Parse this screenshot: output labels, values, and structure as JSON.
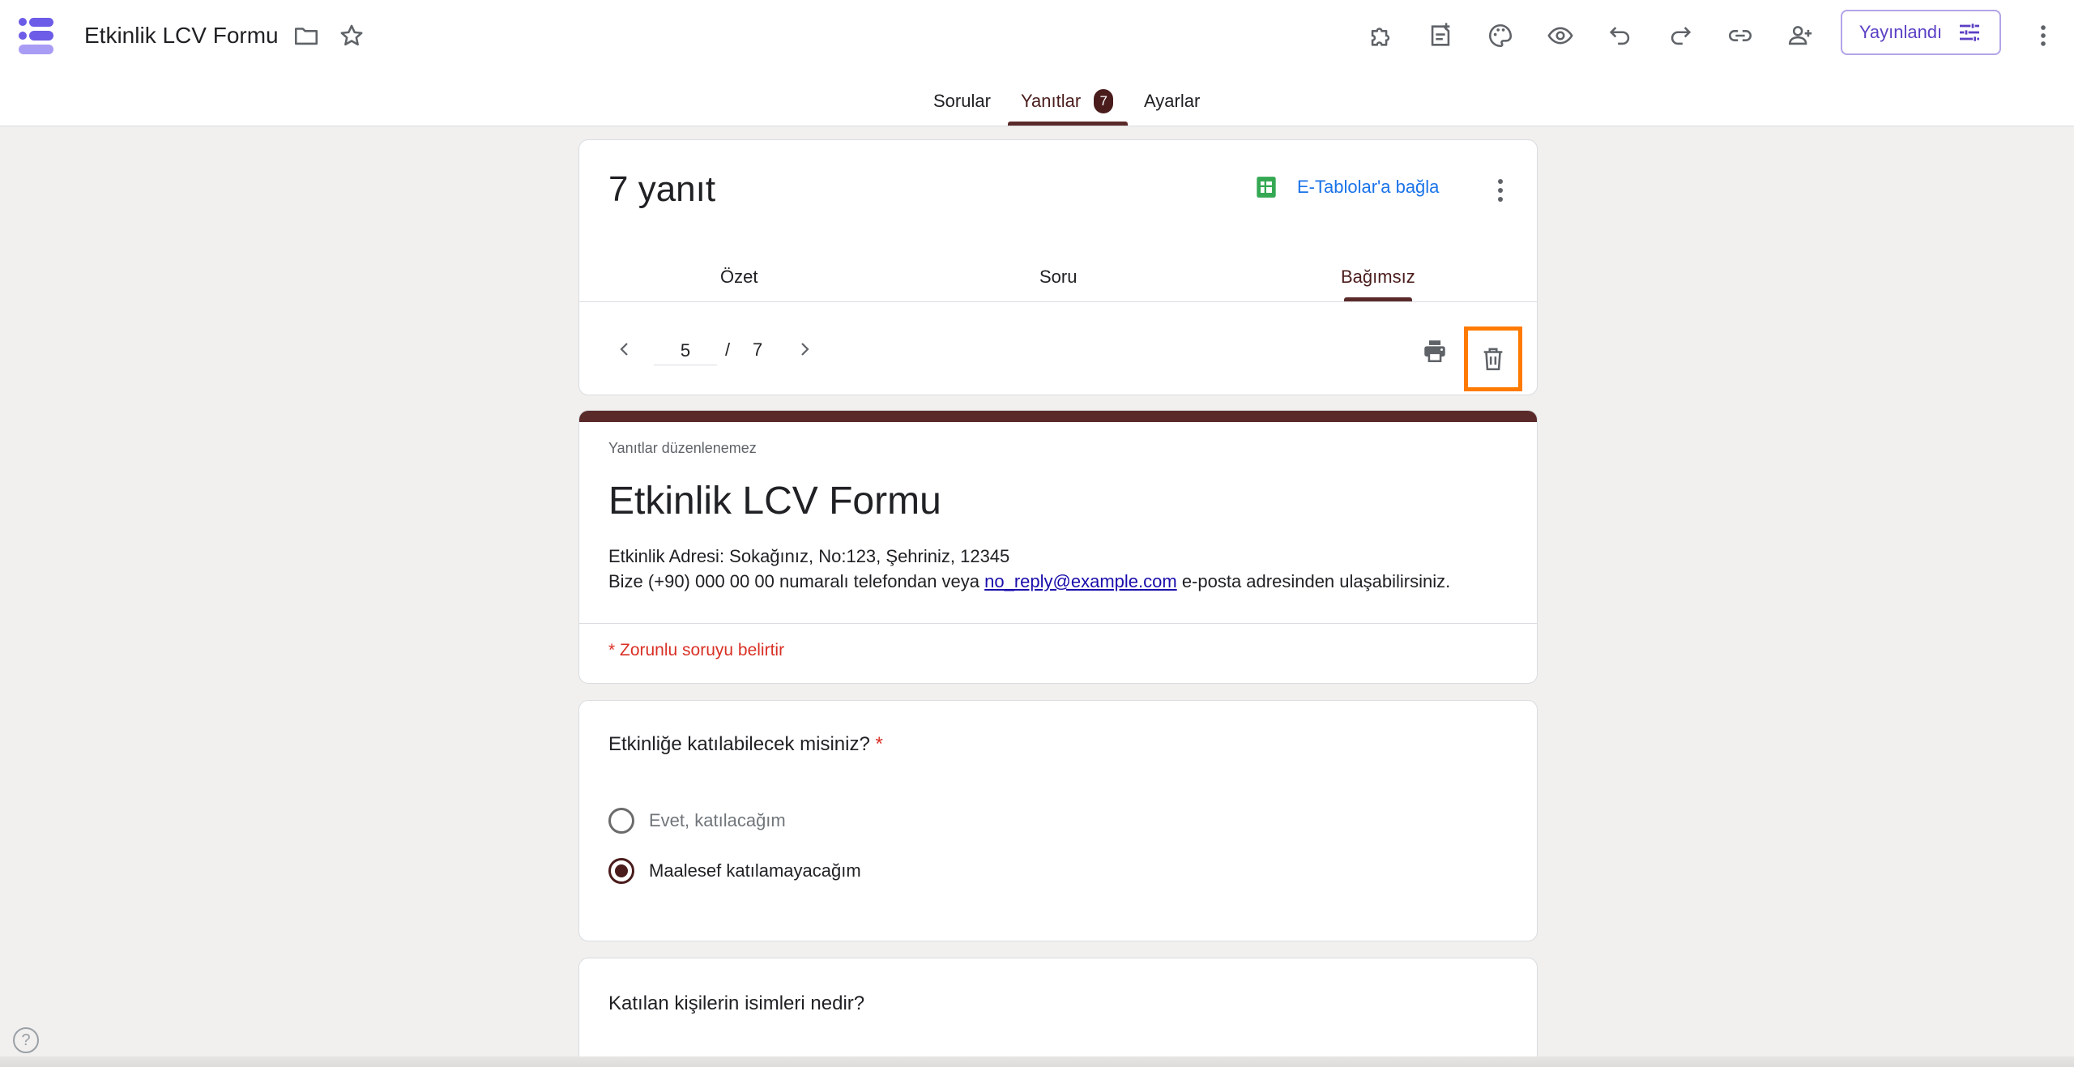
{
  "header": {
    "title": "Etkinlik LCV Formu",
    "publish_label": "Yayınlandı",
    "icons": [
      "app-logo-icon",
      "folder-icon",
      "star-icon",
      "addon-icon",
      "customize-icon",
      "palette-icon",
      "preview-icon",
      "undo-icon",
      "redo-icon",
      "link-icon",
      "add-collaborator-icon",
      "publish-settings-icon",
      "more-vert-icon"
    ]
  },
  "tabs": {
    "questions": "Sorular",
    "responses": "Yanıtlar",
    "responses_badge": "7",
    "settings": "Ayarlar"
  },
  "summary": {
    "count": "7 yanıt",
    "sheets_link": "E-Tablolar'a bağla",
    "subtabs": {
      "summary": "Özet",
      "question": "Soru",
      "individual": "Bağımsız"
    },
    "pager": {
      "current": "5",
      "separator": "/",
      "total": "7"
    }
  },
  "form": {
    "readonly_note": "Yanıtlar düzenlenemez",
    "title": "Etkinlik LCV Formu",
    "desc_line1": "Etkinlik Adresi: Sokağınız, No:123, Şehriniz, 12345",
    "desc_line2_before": "Bize (+90) 000 00 00 numaralı telefondan veya ",
    "desc_email": "no_reply@example.com",
    "desc_line2_after": " e-posta adresinden ulaşabilirsiniz.",
    "required_note": "* Zorunlu soruyu belirtir"
  },
  "questions": [
    {
      "title": "Etkinliğe katılabilecek misiniz?",
      "required_mark": "*",
      "options": [
        "Evet, katılacağım",
        "Maalesef katılamayacağım"
      ],
      "selected": 1
    },
    {
      "title": "Katılan kişilerin isimleri nedir?"
    }
  ],
  "help_label": "?",
  "colors": {
    "accent": "#4a1c1c",
    "highlight": "#ff7a00",
    "publish": "#5b3fc4",
    "link": "#1a73e8"
  }
}
